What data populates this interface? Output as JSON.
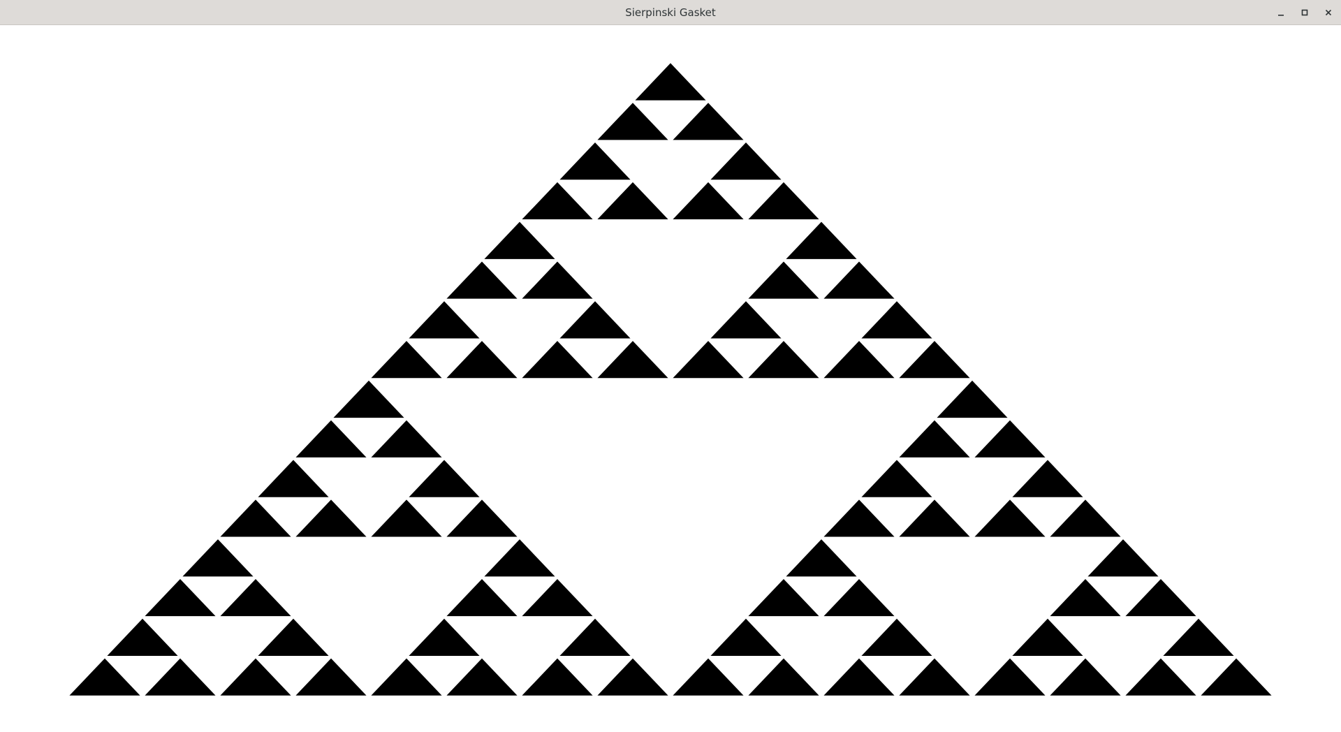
{
  "window": {
    "title": "Sierpinski Gasket",
    "controls": {
      "minimize_icon": "minimize-icon",
      "maximize_icon": "maximize-icon",
      "close_icon": "close-icon"
    }
  },
  "fractal": {
    "name": "sierpinski-gasket",
    "recursion_depth": 4,
    "fill_color": "#000000",
    "background_color": "#ffffff"
  }
}
